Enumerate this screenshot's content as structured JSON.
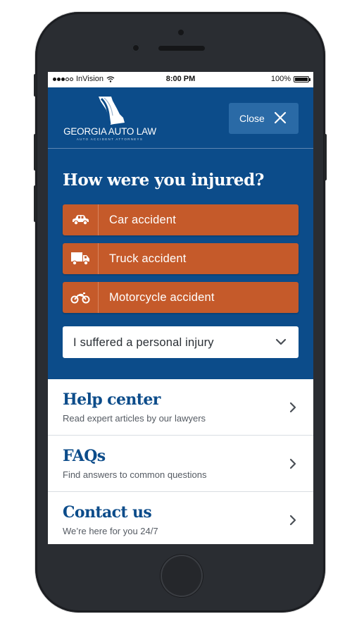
{
  "status_bar": {
    "carrier": "InVision",
    "time": "8:00 PM",
    "battery": "100%"
  },
  "header": {
    "logo_text": "GEORGIA AUTO LAW",
    "logo_tagline": "AUTO ACCIDENT ATTORNEYS",
    "close_label": "Close"
  },
  "injury": {
    "question": "How were you injured?",
    "options": [
      {
        "label": "Car accident",
        "icon": "car-icon"
      },
      {
        "label": "Truck accident",
        "icon": "truck-icon"
      },
      {
        "label": "Motorcycle accident",
        "icon": "motorcycle-icon"
      }
    ],
    "select_value": "I suffered a personal injury"
  },
  "links": [
    {
      "title": "Help center",
      "subtitle": "Read expert articles by our lawyers"
    },
    {
      "title": "FAQs",
      "subtitle": "Find answers to common questions"
    },
    {
      "title": "Contact us",
      "subtitle": "We’re here for you 24/7"
    }
  ],
  "colors": {
    "brand_blue": "#0c4c8a",
    "accent_orange": "#c55a2a",
    "close_button_blue": "#2a6aa6"
  }
}
